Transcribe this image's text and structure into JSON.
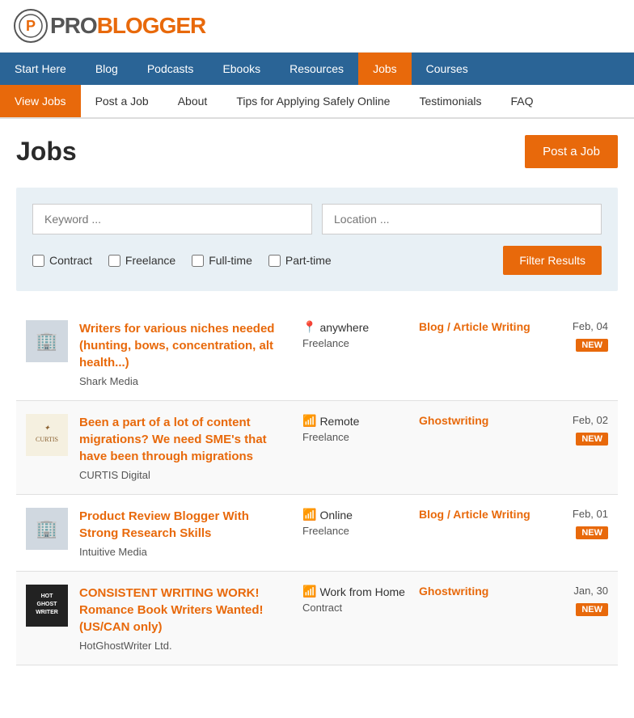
{
  "logo": {
    "pro": "PRO",
    "blogger": "BLOGGER"
  },
  "top_nav": {
    "items": [
      {
        "label": "Start Here",
        "active": false
      },
      {
        "label": "Blog",
        "active": false
      },
      {
        "label": "Podcasts",
        "active": false
      },
      {
        "label": "Ebooks",
        "active": false
      },
      {
        "label": "Resources",
        "active": false
      },
      {
        "label": "Jobs",
        "active": true
      },
      {
        "label": "Courses",
        "active": false
      }
    ]
  },
  "sub_nav": {
    "items": [
      {
        "label": "View Jobs",
        "active": true
      },
      {
        "label": "Post a Job",
        "active": false
      },
      {
        "label": "About",
        "active": false
      },
      {
        "label": "Tips for Applying Safely Online",
        "active": false
      },
      {
        "label": "Testimonials",
        "active": false
      },
      {
        "label": "FAQ",
        "active": false
      }
    ]
  },
  "page": {
    "title": "Jobs",
    "post_job_btn": "Post a Job"
  },
  "search": {
    "keyword_placeholder": "Keyword ...",
    "location_placeholder": "Location ...",
    "filters": [
      {
        "label": "Contract",
        "checked": false
      },
      {
        "label": "Freelance",
        "checked": false
      },
      {
        "label": "Full-time",
        "checked": false
      },
      {
        "label": "Part-time",
        "checked": false
      }
    ],
    "filter_btn": "Filter Results"
  },
  "jobs": [
    {
      "id": 1,
      "title": "Writers for various niches needed (hunting, bows, concentration, alt health...)",
      "company": "Shark Media",
      "location": "anywhere",
      "location_type": "pin",
      "job_type": "Freelance",
      "category": "Blog / Article Writing",
      "date": "Feb, 04",
      "is_new": true,
      "logo_type": "building"
    },
    {
      "id": 2,
      "title": "Been a part of a lot of content migrations? We need SME's that have been through migrations",
      "company": "CURTIS Digital",
      "location": "Remote",
      "location_type": "wifi",
      "job_type": "Freelance",
      "category": "Ghostwriting",
      "date": "Feb, 02",
      "is_new": true,
      "logo_type": "curtis"
    },
    {
      "id": 3,
      "title": "Product Review Blogger With Strong Research Skills",
      "company": "Intuitive Media",
      "location": "Online",
      "location_type": "wifi",
      "job_type": "Freelance",
      "category": "Blog / Article Writing",
      "date": "Feb, 01",
      "is_new": true,
      "logo_type": "building"
    },
    {
      "id": 4,
      "title": "CONSISTENT WRITING WORK! Romance Book Writers Wanted! (US/CAN only)",
      "company": "HotGhostWriter Ltd.",
      "location": "Work from Home",
      "location_type": "wifi",
      "job_type": "Contract",
      "category": "Ghostwriting",
      "date": "Jan, 30",
      "is_new": true,
      "logo_type": "hotghost"
    }
  ],
  "badges": {
    "new": "NEW"
  }
}
